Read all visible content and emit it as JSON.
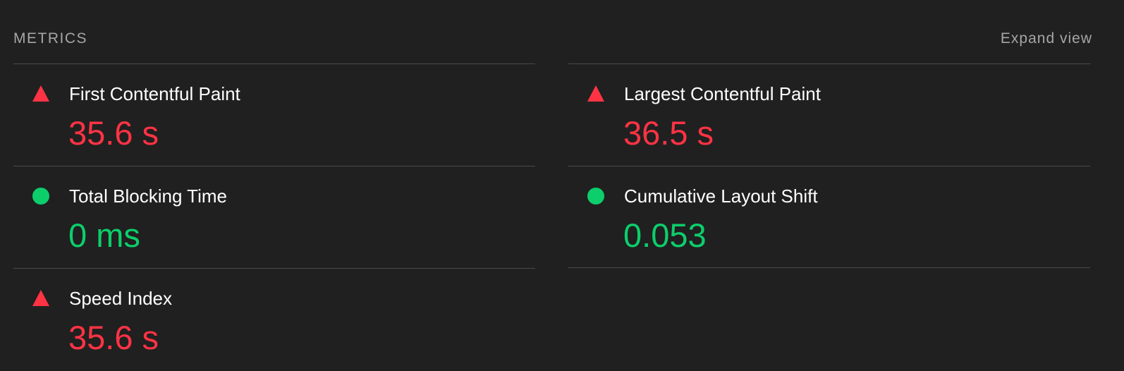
{
  "header": {
    "title": "METRICS",
    "expand_label": "Expand view"
  },
  "colors": {
    "background": "#202020",
    "fail": "#ff3344",
    "pass": "#0cce6b",
    "muted_text": "#a6a6a6",
    "divider": "#4a4a4a"
  },
  "metrics": {
    "fcp": {
      "label": "First Contentful Paint",
      "value": "35.6 s",
      "status": "fail",
      "icon": "red-triangle-icon"
    },
    "lcp": {
      "label": "Largest Contentful Paint",
      "value": "36.5 s",
      "status": "fail",
      "icon": "red-triangle-icon"
    },
    "tbt": {
      "label": "Total Blocking Time",
      "value": "0 ms",
      "status": "pass",
      "icon": "green-circle-icon"
    },
    "cls": {
      "label": "Cumulative Layout Shift",
      "value": "0.053",
      "status": "pass",
      "icon": "green-circle-icon"
    },
    "si": {
      "label": "Speed Index",
      "value": "35.6 s",
      "status": "fail",
      "icon": "red-triangle-icon"
    }
  }
}
